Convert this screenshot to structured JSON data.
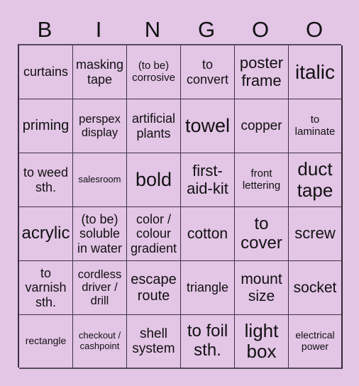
{
  "card": {
    "header": [
      "B",
      "I",
      "N",
      "G",
      "O",
      "O"
    ],
    "cells": [
      [
        "curtains",
        "masking tape",
        "(to be) corrosive",
        "to convert",
        "poster frame",
        "italic"
      ],
      [
        "priming",
        "perspex display",
        "artificial plants",
        "towel",
        "copper",
        "to laminate"
      ],
      [
        "to weed sth.",
        "salesroom",
        "bold",
        "first-aid-kit",
        "front lettering",
        "duct tape"
      ],
      [
        "acrylic",
        "(to be) soluble in water",
        "color / colour gradient",
        "cotton",
        "to cover",
        "screw"
      ],
      [
        "to varnish sth.",
        "cordless driver / drill",
        "escape route",
        "triangle",
        "mount size",
        "socket"
      ],
      [
        "rectangle",
        "checkout / cashpoint",
        "shell system",
        "to foil sth.",
        "light box",
        "electrical power"
      ]
    ]
  },
  "colors": {
    "background": "#e3c5e6",
    "grid_lines": "#3e3442",
    "text": "#111111"
  }
}
